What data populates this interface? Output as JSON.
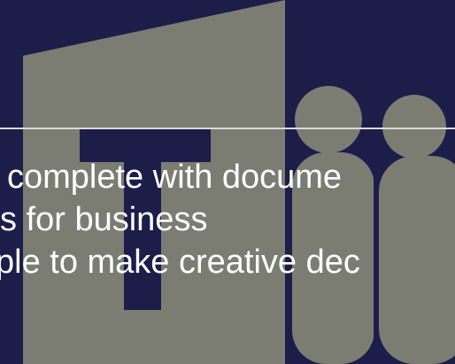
{
  "slide": {
    "lines": [
      "complete with docume",
      "s for business",
      "ple to make creative dec"
    ],
    "colors": {
      "background": "#1c1d49",
      "logo_shape": "#7b7d73",
      "logo_t": "#1c1d49",
      "divider": "#d9d9df",
      "text": "#ffffff"
    },
    "logo_icon": "teams-logo-icon"
  }
}
